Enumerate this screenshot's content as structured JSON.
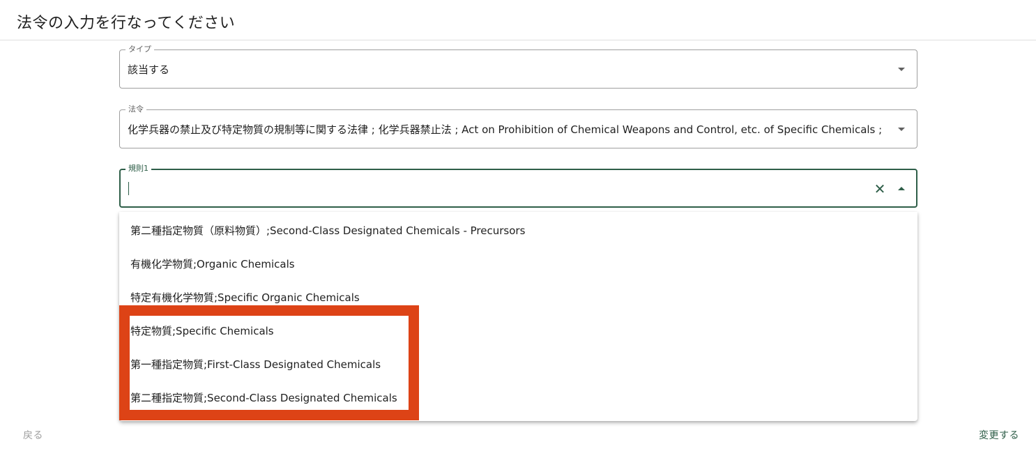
{
  "header": {
    "title": "法令の入力を行なってください"
  },
  "fields": {
    "type": {
      "label": "タイプ",
      "value": "該当する"
    },
    "law": {
      "label": "法令",
      "value": "化学兵器の禁止及び特定物質の規制等に関する法律 ; 化学兵器禁止法 ; Act on Prohibition of Chemical Weapons and Control, etc. of Specific Chemicals ; -"
    },
    "rule1": {
      "label": "規則1",
      "value": "",
      "placeholder": ""
    }
  },
  "dropdown": {
    "options": [
      "第二種指定物質（原料物質）;Second-Class Designated Chemicals - Precursors",
      "有機化学物質;Organic Chemicals",
      "特定有機化学物質;Specific Organic Chemicals",
      "特定物質;Specific Chemicals",
      "第一種指定物質;First-Class Designated Chemicals",
      "第二種指定物質;Second-Class Designated Chemicals"
    ]
  },
  "footer": {
    "back_label": "戻る",
    "change_label": "変更する"
  },
  "icons": {
    "clear": "close-icon",
    "dropdown": "chevron-down-icon",
    "collapse": "chevron-up-icon"
  },
  "colors": {
    "accent": "#2e5e48",
    "highlight": "#dd4316"
  }
}
